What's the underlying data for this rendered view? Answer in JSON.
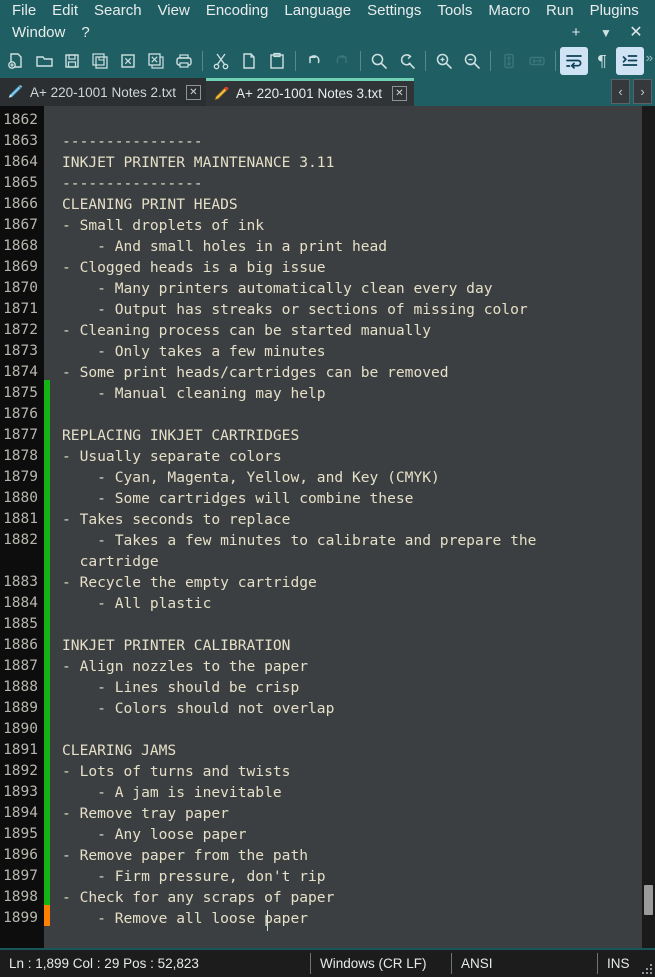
{
  "window": {
    "app": "Notepad++",
    "menu_row1": [
      "File",
      "Edit",
      "Search",
      "View",
      "Encoding",
      "Language",
      "Settings",
      "Tools",
      "Macro",
      "Run",
      "Plugins"
    ],
    "menu_row2": [
      "Window",
      "?"
    ],
    "controls": {
      "plus": "+",
      "dropdown": "▼",
      "close": "✕"
    }
  },
  "toolbar": {
    "overflow": "»",
    "buttons": [
      {
        "name": "new-file-icon",
        "tip": "New"
      },
      {
        "name": "open-folder-icon",
        "tip": "Open"
      },
      {
        "name": "save-icon",
        "tip": "Save"
      },
      {
        "name": "save-all-icon",
        "tip": "Save All"
      },
      {
        "name": "close-file-icon",
        "tip": "Close"
      },
      {
        "name": "close-all-icon",
        "tip": "Close All"
      },
      {
        "name": "print-icon",
        "tip": "Print"
      },
      {
        "name": "cut-scissors-icon",
        "tip": "Cut"
      },
      {
        "name": "copy-icon",
        "tip": "Copy"
      },
      {
        "name": "paste-icon",
        "tip": "Paste"
      },
      {
        "name": "undo-icon",
        "tip": "Undo"
      },
      {
        "name": "redo-icon",
        "tip": "Redo"
      },
      {
        "name": "find-icon",
        "tip": "Find"
      },
      {
        "name": "replace-icon",
        "tip": "Replace"
      },
      {
        "name": "zoom-in-icon",
        "tip": "Zoom In"
      },
      {
        "name": "zoom-out-icon",
        "tip": "Zoom Out"
      },
      {
        "name": "sync-vertical-scroll-icon",
        "tip": "Synchronize Vertical Scrolling"
      },
      {
        "name": "sync-horizontal-scroll-icon",
        "tip": "Synchronize Horizontal Scrolling"
      },
      {
        "name": "word-wrap-icon",
        "tip": "Word wrap",
        "active": true
      },
      {
        "name": "show-all-characters-icon",
        "tip": "Show All Characters"
      },
      {
        "name": "indent-guide-icon",
        "tip": "Show Indent Guide",
        "active": true
      }
    ]
  },
  "tabs": [
    {
      "label": "A+ 220-1001 Notes 2.txt",
      "active": false,
      "modified": false,
      "close": "✕"
    },
    {
      "label": "A+ 220-1001 Notes 3.txt",
      "active": true,
      "modified": true,
      "close": "✕"
    }
  ],
  "tab_nav": {
    "prev": "‹",
    "next": "›"
  },
  "editor": {
    "first_line_number": 1862,
    "caret": {
      "line": 1899,
      "column": 29
    },
    "lines": [
      {
        "n": 1862,
        "text": "",
        "mark": "none"
      },
      {
        "n": 1863,
        "text": "----------------",
        "mark": "none"
      },
      {
        "n": 1864,
        "text": "INKJET PRINTER MAINTENANCE 3.11",
        "mark": "none"
      },
      {
        "n": 1865,
        "text": "----------------",
        "mark": "none"
      },
      {
        "n": 1866,
        "text": "CLEANING PRINT HEADS",
        "mark": "none"
      },
      {
        "n": 1867,
        "text": "- Small droplets of ink",
        "mark": "none"
      },
      {
        "n": 1868,
        "text": "    - And small holes in a print head",
        "mark": "none"
      },
      {
        "n": 1869,
        "text": "- Clogged heads is a big issue",
        "mark": "none"
      },
      {
        "n": 1870,
        "text": "    - Many printers automatically clean every day",
        "mark": "none"
      },
      {
        "n": 1871,
        "text": "    - Output has streaks or sections of missing color",
        "mark": "none"
      },
      {
        "n": 1872,
        "text": "- Cleaning process can be started manually",
        "mark": "none"
      },
      {
        "n": 1873,
        "text": "    - Only takes a few minutes",
        "mark": "none"
      },
      {
        "n": 1874,
        "text": "- Some print heads/cartridges can be removed",
        "mark": "none"
      },
      {
        "n": 1875,
        "text": "    - Manual cleaning may help",
        "mark": "green"
      },
      {
        "n": 1876,
        "text": "",
        "mark": "green"
      },
      {
        "n": 1877,
        "text": "REPLACING INKJET CARTRIDGES",
        "mark": "green"
      },
      {
        "n": 1878,
        "text": "- Usually separate colors",
        "mark": "green"
      },
      {
        "n": 1879,
        "text": "    - Cyan, Magenta, Yellow, and Key (CMYK)",
        "mark": "green"
      },
      {
        "n": 1880,
        "text": "    - Some cartridges will combine these",
        "mark": "green"
      },
      {
        "n": 1881,
        "text": "- Takes seconds to replace",
        "mark": "green"
      },
      {
        "n": 1882,
        "text": "    - Takes a few minutes to calibrate and prepare the",
        "mark": "green",
        "wrap": "  cartridge"
      },
      {
        "n": 1883,
        "text": "- Recycle the empty cartridge",
        "mark": "green"
      },
      {
        "n": 1884,
        "text": "    - All plastic",
        "mark": "green"
      },
      {
        "n": 1885,
        "text": "",
        "mark": "green"
      },
      {
        "n": 1886,
        "text": "INKJET PRINTER CALIBRATION",
        "mark": "green"
      },
      {
        "n": 1887,
        "text": "- Align nozzles to the paper",
        "mark": "green"
      },
      {
        "n": 1888,
        "text": "    - Lines should be crisp",
        "mark": "green"
      },
      {
        "n": 1889,
        "text": "    - Colors should not overlap",
        "mark": "green"
      },
      {
        "n": 1890,
        "text": "",
        "mark": "green"
      },
      {
        "n": 1891,
        "text": "CLEARING JAMS",
        "mark": "green"
      },
      {
        "n": 1892,
        "text": "- Lots of turns and twists",
        "mark": "green"
      },
      {
        "n": 1893,
        "text": "    - A jam is inevitable",
        "mark": "green"
      },
      {
        "n": 1894,
        "text": "- Remove tray paper",
        "mark": "green"
      },
      {
        "n": 1895,
        "text": "    - Any loose paper",
        "mark": "green"
      },
      {
        "n": 1896,
        "text": "- Remove paper from the path",
        "mark": "green"
      },
      {
        "n": 1897,
        "text": "    - Firm pressure, don't rip",
        "mark": "green"
      },
      {
        "n": 1898,
        "text": "- Check for any scraps of paper",
        "mark": "green"
      },
      {
        "n": 1899,
        "text": "    - Remove all loose paper",
        "mark": "orange"
      }
    ]
  },
  "statusbar": {
    "position": "Ln : 1,899    Col : 29    Pos : 52,823",
    "eol": "Windows (CR LF)",
    "encoding": "ANSI",
    "insert_mode": "INS"
  },
  "colors": {
    "chrome": "#1f5f63",
    "editor_bg": "#3c3f41",
    "gutter_bg": "#0d0d0d",
    "text": "#e5dfc8",
    "marker_saved": "#13b413",
    "marker_unsaved": "#ff8000",
    "tab_active_top": "#6fd0b4"
  }
}
